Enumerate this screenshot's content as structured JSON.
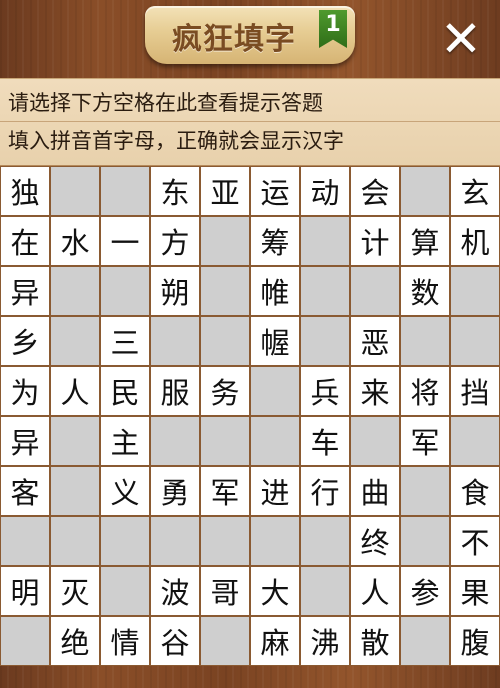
{
  "header": {
    "title": "疯狂填字",
    "level": "1",
    "close_label": "✕"
  },
  "hints": [
    "请选择下方空格在此查看提示答题",
    "填入拼音首字母，正确就会显示汉字"
  ],
  "colors": {
    "wood": "#7a4322",
    "letter_cell": "#ffffff",
    "blank_cell": "#cfcfcf",
    "hint_bg": "#e8d1ac",
    "flag": "#3f8224"
  },
  "board": {
    "cols": 10,
    "rows": 10,
    "cells": [
      [
        "独",
        "?",
        "?",
        "东",
        "亚",
        "运",
        "动",
        "会",
        "?",
        "玄"
      ],
      [
        "在",
        "水",
        "一",
        "方",
        "?",
        "筹",
        "?",
        "计",
        "算",
        "机"
      ],
      [
        "异",
        "?",
        "?",
        "朔",
        "?",
        "帷",
        "?",
        "?",
        "数",
        "?"
      ],
      [
        "乡",
        "?",
        "三",
        "?",
        "?",
        "幄",
        "?",
        "恶",
        "?",
        "?"
      ],
      [
        "为",
        "人",
        "民",
        "服",
        "务",
        "?",
        "兵",
        "来",
        "将",
        "挡"
      ],
      [
        "异",
        "?",
        "主",
        "?",
        "?",
        "?",
        "车",
        "?",
        "军",
        "?"
      ],
      [
        "客",
        "?",
        "义",
        "勇",
        "军",
        "进",
        "行",
        "曲",
        "?",
        "食"
      ],
      [
        "?",
        "?",
        "?",
        "?",
        "?",
        "?",
        "?",
        "终",
        "?",
        "不"
      ],
      [
        "明",
        "灭",
        "?",
        "波",
        "哥",
        "大",
        "?",
        "人",
        "参",
        "果"
      ],
      [
        "?",
        "绝",
        "情",
        "谷",
        "?",
        "麻",
        "沸",
        "散",
        "?",
        "腹"
      ]
    ]
  }
}
